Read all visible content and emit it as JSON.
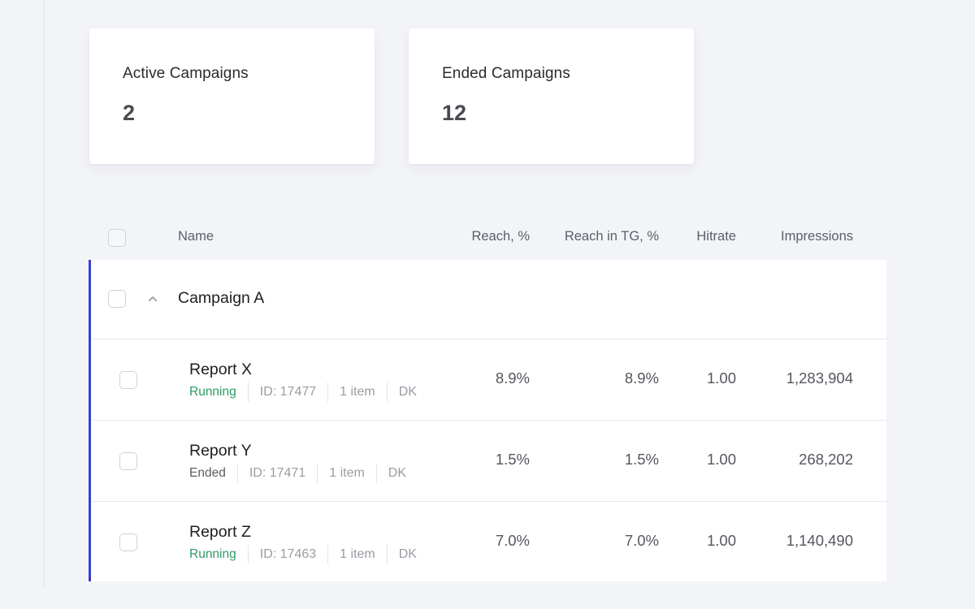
{
  "stats": [
    {
      "label": "Active Campaigns",
      "value": "2"
    },
    {
      "label": "Ended Campaigns",
      "value": "12"
    }
  ],
  "table": {
    "columns": {
      "name": "Name",
      "reach": "Reach, %",
      "reach_tg": "Reach in TG, %",
      "hitrate": "Hitrate",
      "impressions": "Impressions"
    },
    "group": {
      "name": "Campaign A",
      "expanded": true
    },
    "rows": [
      {
        "name": "Report X",
        "status": "Running",
        "id": "ID: 17477",
        "items": "1 item",
        "country": "DK",
        "reach": "8.9%",
        "reach_tg": "8.9%",
        "hitrate": "1.00",
        "impressions": "1,283,904"
      },
      {
        "name": "Report Y",
        "status": "Ended",
        "id": "ID: 17471",
        "items": "1 item",
        "country": "DK",
        "reach": "1.5%",
        "reach_tg": "1.5%",
        "hitrate": "1.00",
        "impressions": "268,202"
      },
      {
        "name": "Report Z",
        "status": "Running",
        "id": "ID: 17463",
        "items": "1 item",
        "country": "DK",
        "reach": "7.0%",
        "reach_tg": "7.0%",
        "hitrate": "1.00",
        "impressions": "1,140,490"
      }
    ]
  },
  "colors": {
    "accent": "#3a3fd0",
    "running": "#2e9a63",
    "ended": "#5a5c63",
    "background": "#f3f4f8"
  },
  "icons": {
    "expand": "chevron-up-icon",
    "select": "checkbox"
  }
}
